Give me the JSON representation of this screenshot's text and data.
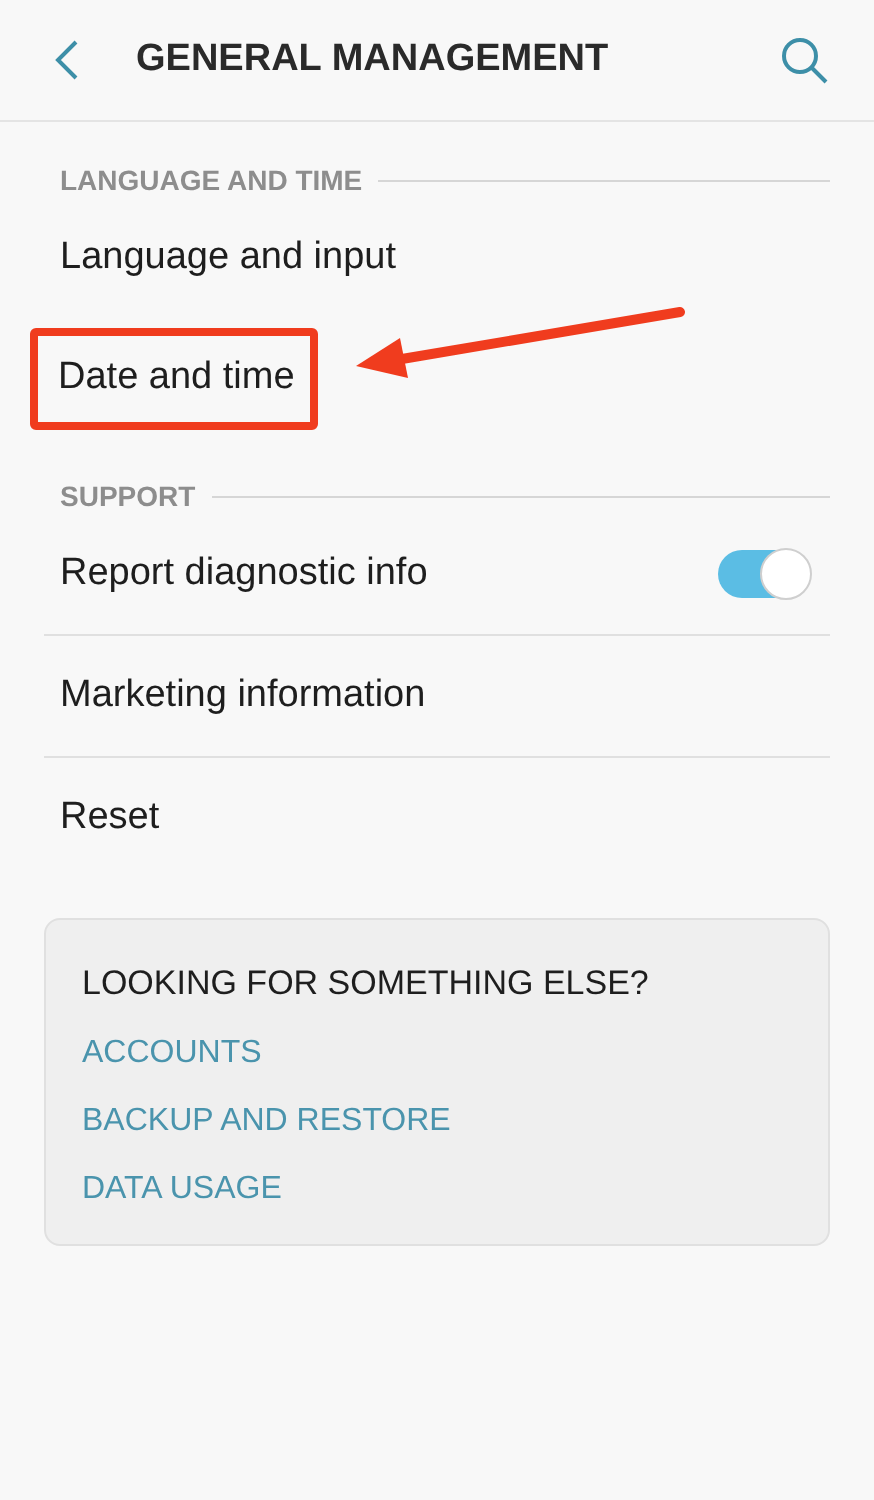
{
  "header": {
    "title": "GENERAL MANAGEMENT"
  },
  "sections": [
    {
      "title": "LANGUAGE AND TIME",
      "items": [
        {
          "kind": "plain",
          "label": "Language and input",
          "highlighted": false
        },
        {
          "kind": "plain",
          "label": "Date and time",
          "highlighted": true
        }
      ]
    },
    {
      "title": "SUPPORT",
      "items": [
        {
          "kind": "toggle",
          "label": "Report diagnostic info",
          "on": true,
          "highlighted": false
        },
        {
          "kind": "plain",
          "label": "Marketing information",
          "highlighted": false
        },
        {
          "kind": "plain",
          "label": "Reset",
          "highlighted": false
        }
      ]
    }
  ],
  "suggestions": {
    "title": "LOOKING FOR SOMETHING ELSE?",
    "links": [
      "ACCOUNTS",
      "BACKUP AND RESTORE",
      "DATA USAGE"
    ]
  }
}
